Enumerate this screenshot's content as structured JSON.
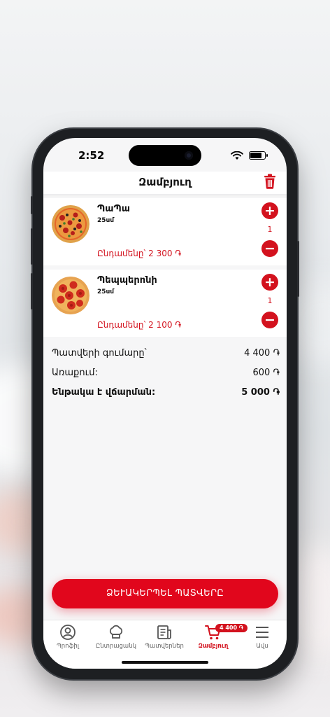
{
  "status": {
    "time": "2:52"
  },
  "header": {
    "title": "Զամբյուղ",
    "trash_icon": "trash-icon"
  },
  "cart": {
    "items": [
      {
        "name": "ՊաՊա",
        "size": "25սմ",
        "total": "Ընդամենը՝ 2 300 ֏",
        "quantity": "1"
      },
      {
        "name": "Պեպպերոնի",
        "size": "25սմ",
        "total": "Ընդամենը՝ 2 100 ֏",
        "quantity": "1"
      }
    ]
  },
  "summary": {
    "subtotal_label": "Պատվերի գումարը՝",
    "subtotal_value": "4 400 ֏",
    "delivery_label": "Առաքում:",
    "delivery_value": "600 ֏",
    "total_label": "Ենթակա է վճարման:",
    "total_value": "5 000 ֏"
  },
  "checkout": {
    "label": "ՁԵՒԱԿԵՐՊԵԼ ՊԱՏՎԵՐԸ"
  },
  "tabbar": {
    "badge": "4 400 ֏",
    "tabs": [
      {
        "label": "Պրոֆիլ",
        "icon": "profile-icon"
      },
      {
        "label": "Ընտրացանկ",
        "icon": "chef-hat-icon"
      },
      {
        "label": "Պատվերներ",
        "icon": "orders-icon"
      },
      {
        "label": "Զամբյուղ",
        "icon": "cart-icon"
      },
      {
        "label": "Ավս",
        "icon": "menu-icon"
      }
    ]
  },
  "colors": {
    "accent": "#d3121e",
    "checkout": "#e1061c"
  }
}
